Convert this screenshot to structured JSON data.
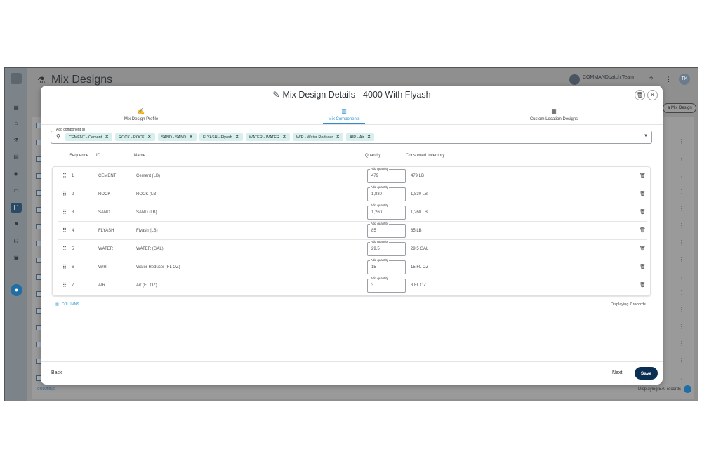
{
  "background": {
    "page_title": "Mix Designs",
    "team_name": "COMMANDbatch Team",
    "user_initials": "TK",
    "add_button": "a Mix Design",
    "footer_columns": "COLUMNS",
    "footer_records": "Displaying 570 records"
  },
  "modal": {
    "title": "Mix Design Details - 4000 With Flyash",
    "tabs": [
      {
        "label": "Mix Design Profile",
        "icon": "edit-signature-icon"
      },
      {
        "label": "Mix Components",
        "icon": "grid-icon",
        "active": true
      },
      {
        "label": "Custom Location Designs",
        "icon": "calendar-icon"
      }
    ],
    "components_label": "Add component(s)",
    "chips": [
      "CEMENT - Cement",
      "ROCK - ROCK",
      "SAND - SAND",
      "FLYASH - Flyash",
      "WATER - WATER",
      "W/R - Water Reducer",
      "AIR - Air"
    ],
    "columns": {
      "sequence": "Sequence",
      "id": "ID",
      "name": "Name",
      "quantity": "Quantity",
      "consumed": "Consumed Inventory"
    },
    "quantity_label": "Add quantity",
    "rows": [
      {
        "seq": "1",
        "id": "CEMENT",
        "name": "Cement (LB)",
        "qty": "479",
        "consumed": "479 LB"
      },
      {
        "seq": "2",
        "id": "ROCK",
        "name": "ROCK (LB)",
        "qty": "1,830",
        "consumed": "1,830 LB"
      },
      {
        "seq": "3",
        "id": "SAND",
        "name": "SAND (LB)",
        "qty": "1,260",
        "consumed": "1,260 LB"
      },
      {
        "seq": "4",
        "id": "FLYASH",
        "name": "Flyash (LB)",
        "qty": "85",
        "consumed": "85 LB"
      },
      {
        "seq": "5",
        "id": "WATER",
        "name": "WATER (GAL)",
        "qty": "29.5",
        "consumed": "29.5 GAL"
      },
      {
        "seq": "6",
        "id": "W/R",
        "name": "Water Reducer (FL OZ)",
        "qty": "15",
        "consumed": "15 FL OZ"
      },
      {
        "seq": "7",
        "id": "AIR",
        "name": "Air (FL OZ)",
        "qty": "3",
        "consumed": "3 FL OZ"
      }
    ],
    "columns_link": "COLUMNS",
    "records_text": "Displaying 7 records",
    "back_label": "Back",
    "next_label": "Next",
    "save_label": "Save"
  },
  "colors": {
    "accent": "#2d8fd0",
    "save_button": "#0b2f52",
    "chip": "#d8f0ed"
  }
}
